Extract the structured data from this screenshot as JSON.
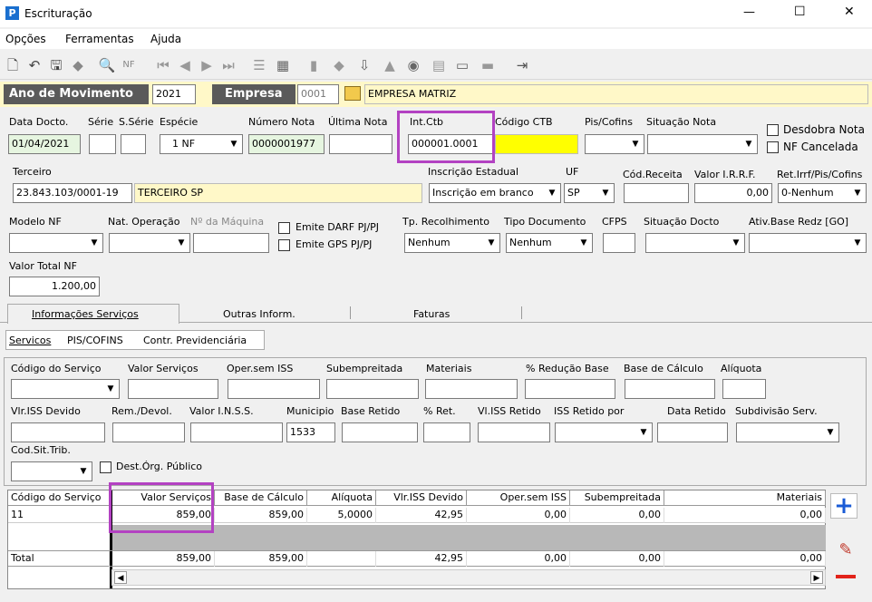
{
  "window": {
    "title": "Escrituração",
    "minimize": "—",
    "maximize": "☐",
    "close": "✕"
  },
  "menu": {
    "opcoes": "Opções",
    "ferramentas": "Ferramentas",
    "ajuda": "Ajuda"
  },
  "header": {
    "ano_label": "Ano de Movimento",
    "ano_value": "2021",
    "empresa_label": "Empresa",
    "empresa_code": "0001",
    "empresa_name": "EMPRESA MATRIZ"
  },
  "nota": {
    "data_docto_label": "Data Docto.",
    "data_docto": "01/04/2021",
    "serie_label": "Série",
    "sserie_label": "S.Série",
    "especie_label": "Espécie",
    "especie_value": "1 NF",
    "numero_nota_label": "Número Nota",
    "numero_nota": "0000001977",
    "ultima_nota_label": "Última Nota",
    "intctb_label": "Int.Ctb",
    "intctb_value": "000001.0001",
    "codigo_ctb_label": "Código CTB",
    "piscofins_label": "Pis/Cofins",
    "situacao_label": "Situação Nota",
    "desdobra_label": "Desdobra Nota",
    "cancelada_label": "NF Cancelada"
  },
  "terceiro": {
    "label": "Terceiro",
    "cnpj": "23.843.103/0001-19",
    "nome": "TERCEIRO SP",
    "ie_label": "Inscrição Estadual",
    "ie_value": "Inscrição em branco",
    "uf_label": "UF",
    "uf_value": "SP",
    "cod_receita_label": "Cód.Receita",
    "irrf_label": "Valor I.R.R.F.",
    "irrf_value": "0,00",
    "ret_label": "Ret.Irrf/Pis/Cofins",
    "ret_value": "0-Nenhum"
  },
  "modelo": {
    "modelo_label": "Modelo NF",
    "nat_label": "Nat. Operação",
    "maquina_label": "Nº da Máquina",
    "darf_label": "Emite DARF PJ/PJ",
    "gps_label": "Emite GPS PJ/PJ",
    "tp_rec_label": "Tp. Recolhimento",
    "tp_rec_value": "Nenhum",
    "tipo_doc_label": "Tipo Documento",
    "tipo_doc_value": "Nenhum",
    "cfps_label": "CFPS",
    "sit_docto_label": "Situação Docto",
    "ativ_label": "Ativ.Base Redz [GO]",
    "valor_total_label": "Valor Total NF",
    "valor_total": "1.200,00"
  },
  "tabs": {
    "info_servicos": "Informações Serviços",
    "outras": "Outras Inform.",
    "faturas": "Faturas"
  },
  "subtabs": {
    "servicos": "Servicos",
    "piscofins": "PIS/COFINS",
    "contr": "Contr. Previdenciária"
  },
  "servico": {
    "codigo_label": "Código do Serviço",
    "valor_label": "Valor Serviços",
    "oper_label": "Oper.sem ISS",
    "subemp_label": "Subempreitada",
    "materiais_label": "Materiais",
    "reducao_label": "% Redução Base",
    "base_label": "Base de Cálculo",
    "aliquota_label": "Alíquota",
    "vlr_iss_label": "Vlr.ISS Devido",
    "rem_label": "Rem./Devol.",
    "inss_label": "Valor I.N.S.S.",
    "municipio_label": "Municipio",
    "municipio_value": "1533",
    "base_ret_label": "Base Retido",
    "pct_ret_label": "% Ret.",
    "vl_iss_ret_label": "Vl.ISS Retido",
    "iss_ret_por_label": "ISS Retido por",
    "data_ret_label": "Data Retido",
    "subdiv_label": "Subdivisão Serv.",
    "cod_sit_label": "Cod.Sit.Trib.",
    "dest_label": "Dest.Órg. Público"
  },
  "grid": {
    "headers": [
      "Código do Serviço",
      "Valor Serviços",
      "Base de Cálculo",
      "Alíquota",
      "Vlr.ISS Devido",
      "Oper.sem ISS",
      "Subempreitada",
      "Materiais"
    ],
    "row": [
      "11",
      "859,00",
      "859,00",
      "5,0000",
      "42,95",
      "0,00",
      "0,00",
      "0,00"
    ],
    "total": [
      "Total",
      "859,00",
      "859,00",
      "",
      "42,95",
      "0,00",
      "0,00",
      "0,00"
    ]
  }
}
